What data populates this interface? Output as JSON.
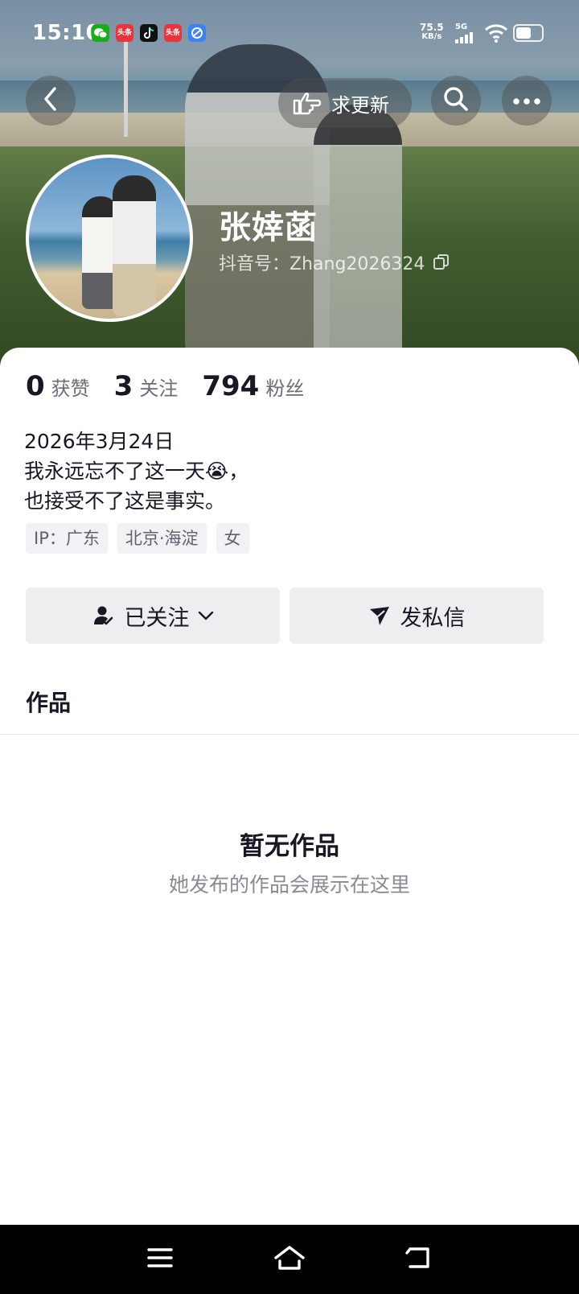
{
  "status_bar": {
    "time": "15:10",
    "network_speed": "75.5",
    "network_speed_unit": "KB/s",
    "network_type": "5G",
    "notification_apps": [
      {
        "name": "wechat-icon",
        "color": "#1aad19",
        "label": ""
      },
      {
        "name": "toutiao-icon",
        "color": "#e8343a",
        "label": "头条"
      },
      {
        "name": "tiktok-icon",
        "color": "#111111",
        "label": ""
      },
      {
        "name": "toutiao-icon",
        "color": "#e8343a",
        "label": "头条"
      },
      {
        "name": "browser-icon",
        "color": "#3b82f6",
        "label": ""
      }
    ],
    "battery_percent": 60
  },
  "top_nav": {
    "back_icon": "chevron-left-icon",
    "request_update_label": "求更新",
    "request_update_icon": "pointing-hand-icon",
    "search_icon": "search-icon",
    "more_icon": "more-horizontal-icon"
  },
  "profile": {
    "name": "张婞菡",
    "douyin_id": "抖音号：Zhang2026324",
    "copy_icon": "copy-icon"
  },
  "stats": [
    {
      "value": "0",
      "label": "获赞"
    },
    {
      "value": "3",
      "label": "关注"
    },
    {
      "value": "794",
      "label": "粉丝"
    }
  ],
  "bio": {
    "line1": "2026年3月24日",
    "line2": "我永远忘不了这一天😭，",
    "line3": "也接受不了这是事实。"
  },
  "tags": [
    "IP：广东",
    "北京·海淀",
    "女"
  ],
  "actions": {
    "following_label": "已关注",
    "following_icon": "user-check-icon",
    "message_label": "发私信",
    "message_icon": "send-icon"
  },
  "tabs": {
    "works_label": "作品"
  },
  "empty_state": {
    "title": "暂无作品",
    "subtitle": "她发布的作品会展示在这里"
  },
  "system_nav": {
    "menu_icon": "menu-icon",
    "home_icon": "home-icon",
    "back_icon": "back-icon"
  },
  "colors": {
    "primary_text": "#161823",
    "secondary_text": "#6b6d76",
    "button_bg": "#eeeef0",
    "tag_bg": "#f2f2f4"
  }
}
